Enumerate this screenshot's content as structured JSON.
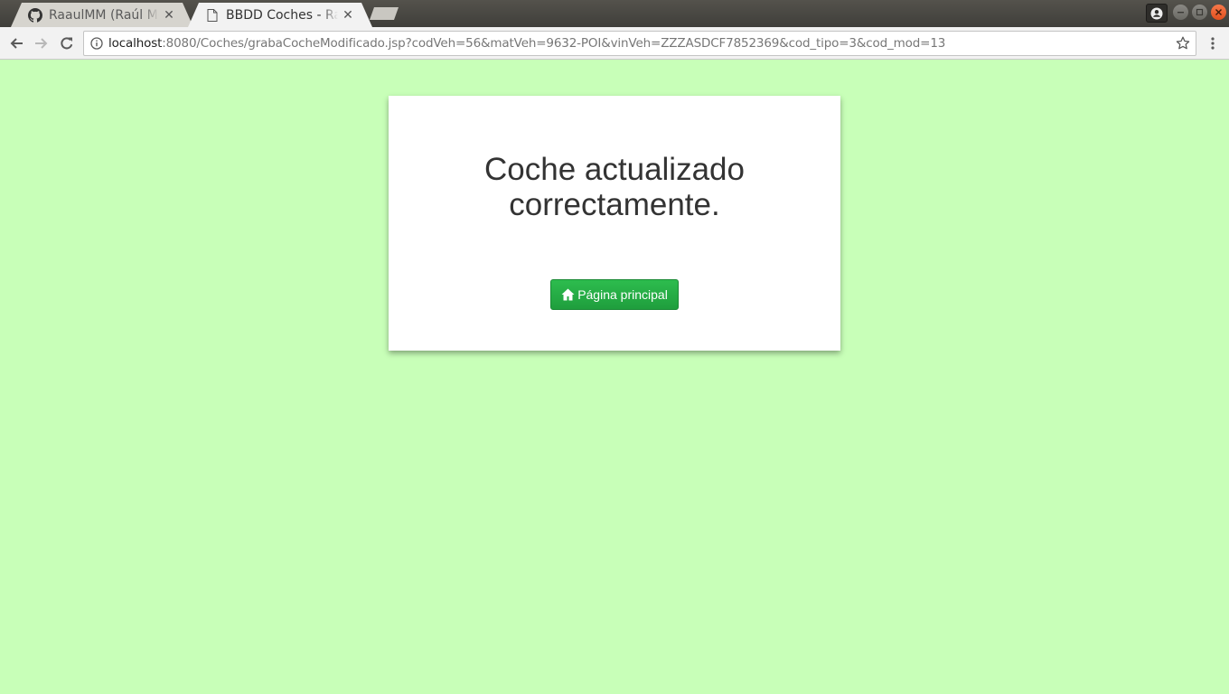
{
  "browser": {
    "tabs": [
      {
        "title": "RaaulMM (Raúl Mor",
        "icon": "github-icon",
        "active": false
      },
      {
        "title": "BBDD Coches - Raúl",
        "icon": "page-icon",
        "active": true
      }
    ],
    "url": {
      "host": "localhost",
      "rest": ":8080/Coches/grabaCocheModificado.jsp?codVeh=56&matVeh=9632-POI&vinVeh=ZZZASDCF7852369&cod_tipo=3&cod_mod=13"
    }
  },
  "page": {
    "message": "Coche actualizado correctamente.",
    "home_button_label": "Página principal",
    "home_button_icon": "home-icon",
    "background_color": "#c8ffb8",
    "button_color": "#28a745"
  }
}
